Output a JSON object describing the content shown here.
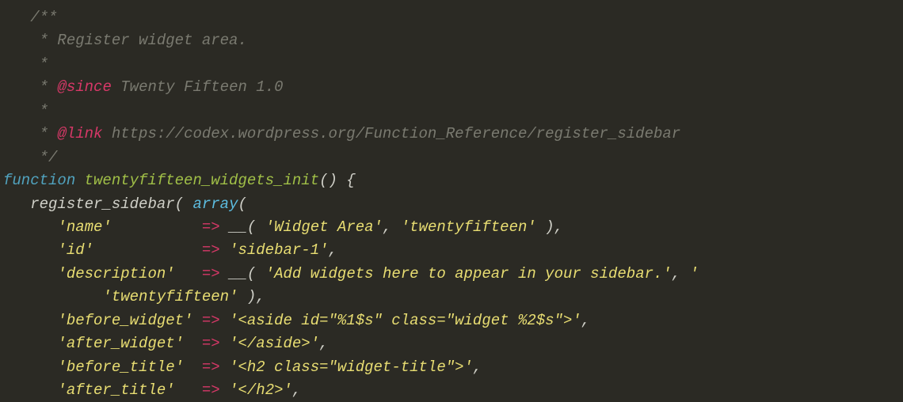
{
  "code": {
    "c1": "/**",
    "c2": " * Register widget area.",
    "c3": " *",
    "c4_pre": " * ",
    "c4_tag": "@since",
    "c4_rest": " Twenty Fifteen 1.0",
    "c5": " *",
    "c6_pre": " * ",
    "c6_tag": "@link",
    "c6_rest": " https://codex.wordpress.org/Function_Reference/register_sidebar",
    "c7": " */",
    "kw_function": "function",
    "fn_name": " twentyfifteen_widgets_init",
    "fn_open": "() {",
    "call_register": "register_sidebar",
    "call_array": "array",
    "paren_open": "( ",
    "paren_open2": "(",
    "indent1": "   ",
    "indent2": "      ",
    "indent3": "         ",
    "k_name": "'name'",
    "pad_name": "          ",
    "arrow": "=>",
    "sp": " ",
    "call_us": "__",
    "s_widget_area": "'Widget Area'",
    "comma_sp": ", ",
    "s_tf": "'twentyfifteen'",
    "close_paren_comma": " ),",
    "k_id": "'id'",
    "pad_id": "            ",
    "s_sidebar1": "'sidebar-1'",
    "comma": ",",
    "k_desc": "'description'",
    "pad_desc": "   ",
    "s_desc": "'Add widgets here to appear in your sidebar.'",
    "cont_sq": "'",
    "wrap_indent": "           ",
    "k_before_widget": "'before_widget'",
    "s_before_widget": "'<aside id=\"%1$s\" class=\"widget %2$s\">'",
    "k_after_widget": "'after_widget'",
    "pad_aw": " ",
    "s_after_widget": "'</aside>'",
    "k_before_title": "'before_title'",
    "pad_bt": " ",
    "s_before_title": "'<h2 class=\"widget-title\">'",
    "k_after_title": "'after_title'",
    "pad_at": "  ",
    "s_after_title": "'</h2>'"
  }
}
